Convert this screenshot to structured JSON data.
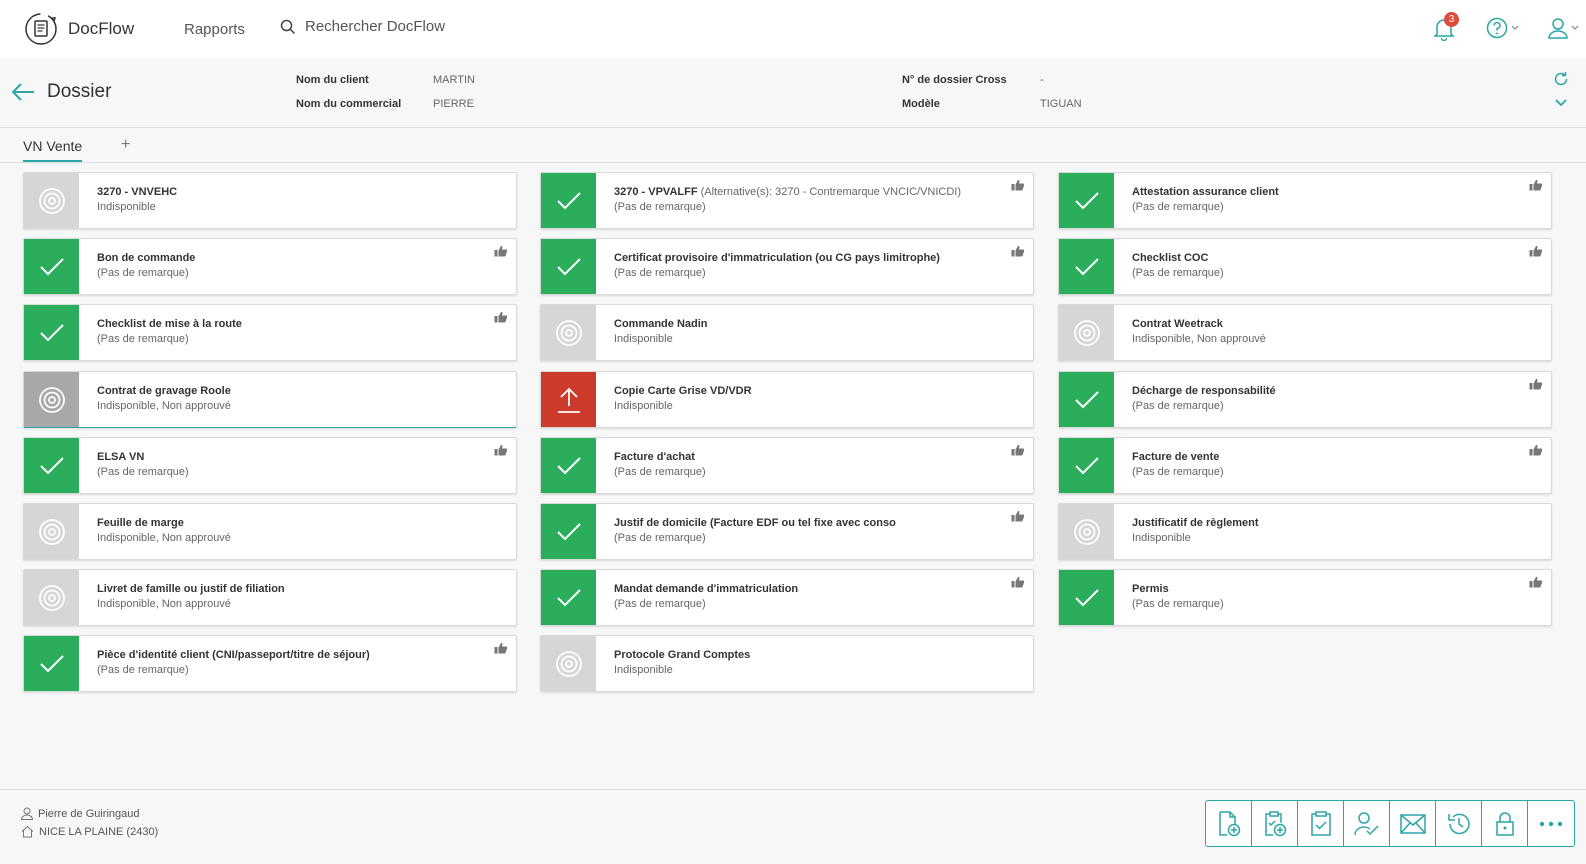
{
  "app": {
    "name": "DocFlow",
    "nav_rapports": "Rapports",
    "search_placeholder": "Rechercher DocFlow",
    "notifications_count": "3"
  },
  "dossier": {
    "title": "Dossier",
    "fields": [
      {
        "label": "Nom du client",
        "value": "MARTIN"
      },
      {
        "label": "Nom du commercial",
        "value": "PIERRE"
      },
      {
        "label": "N° de dossier Cross",
        "value": "-"
      },
      {
        "label": "Modèle",
        "value": "TIGUAN"
      }
    ]
  },
  "tabs": [
    {
      "label": "VN Vente"
    }
  ],
  "tab_add": "+",
  "colors": {
    "ok": "#2bae5c",
    "unavailable": "#d6d6d6",
    "upload": "#cc3a2b",
    "accent": "#2aa6a6"
  },
  "documents": [
    {
      "title": "3270 - VNVEHC",
      "alt": "",
      "status": "Indisponible",
      "state": "unavailable",
      "approved": false
    },
    {
      "title": "3270 - VPVALFF",
      "alt": " (Alternative(s): 3270 - Contremarque VNCIC/VNICDI)",
      "status": "(Pas de remarque)",
      "state": "ok",
      "approved": true
    },
    {
      "title": "Attestation assurance client",
      "alt": "",
      "status": "(Pas de remarque)",
      "state": "ok",
      "approved": true
    },
    {
      "title": "Bon de commande",
      "alt": "",
      "status": "(Pas de remarque)",
      "state": "ok",
      "approved": true
    },
    {
      "title": "Certificat provisoire d'immatriculation (ou CG pays limitrophe)",
      "alt": "",
      "status": "(Pas de remarque)",
      "state": "ok",
      "approved": true
    },
    {
      "title": "Checklist COC",
      "alt": "",
      "status": "(Pas de remarque)",
      "state": "ok",
      "approved": true
    },
    {
      "title": "Checklist de mise à la route",
      "alt": "",
      "status": "(Pas de remarque)",
      "state": "ok",
      "approved": true
    },
    {
      "title": "Commande Nadin",
      "alt": "",
      "status": "Indisponible",
      "state": "unavailable",
      "approved": false
    },
    {
      "title": "Contrat Weetrack",
      "alt": "",
      "status": "Indisponible, Non approuvé",
      "state": "unavailable",
      "approved": false
    },
    {
      "title": "Contrat de gravage Roole",
      "alt": "",
      "status": "Indisponible, Non approuvé",
      "state": "unavailable-focused",
      "approved": false
    },
    {
      "title": "Copie Carte Grise VD/VDR",
      "alt": "",
      "status": "Indisponible",
      "state": "upload",
      "approved": false
    },
    {
      "title": "Décharge de responsabilité",
      "alt": "",
      "status": "(Pas de remarque)",
      "state": "ok",
      "approved": true
    },
    {
      "title": "ELSA VN",
      "alt": "",
      "status": "(Pas de remarque)",
      "state": "ok",
      "approved": true
    },
    {
      "title": "Facture d'achat",
      "alt": "",
      "status": "(Pas de remarque)",
      "state": "ok",
      "approved": true
    },
    {
      "title": "Facture de vente",
      "alt": "",
      "status": "(Pas de remarque)",
      "state": "ok",
      "approved": true
    },
    {
      "title": "Feuille de marge",
      "alt": "",
      "status": "Indisponible, Non approuvé",
      "state": "unavailable",
      "approved": false
    },
    {
      "title": "Justif de domicile (Facture EDF ou tel fixe avec conso",
      "alt": "",
      "status": "(Pas de remarque)",
      "state": "ok",
      "approved": true
    },
    {
      "title": "Justificatif de règlement",
      "alt": "",
      "status": "Indisponible",
      "state": "unavailable",
      "approved": false
    },
    {
      "title": "Livret de famille ou justif de filiation",
      "alt": "",
      "status": "Indisponible, Non approuvé",
      "state": "unavailable",
      "approved": false
    },
    {
      "title": "Mandat demande d'immatriculation",
      "alt": "",
      "status": "(Pas de remarque)",
      "state": "ok",
      "approved": true
    },
    {
      "title": "Permis",
      "alt": "",
      "status": "(Pas de remarque)",
      "state": "ok",
      "approved": true
    },
    {
      "title": "Pièce d'identité client (CNI/passeport/titre de séjour)",
      "alt": "",
      "status": "(Pas de remarque)",
      "state": "ok",
      "approved": true
    },
    {
      "title": "Protocole Grand Comptes",
      "alt": "",
      "status": "Indisponible",
      "state": "unavailable",
      "approved": false
    }
  ],
  "footer": {
    "user": "Pierre de Guiringaud",
    "site": "NICE LA PLAINE (2430)"
  },
  "actions": [
    {
      "name": "add-document-icon"
    },
    {
      "name": "add-checklist-icon"
    },
    {
      "name": "checklist-icon"
    },
    {
      "name": "user-validate-icon"
    },
    {
      "name": "mail-icon"
    },
    {
      "name": "history-icon"
    },
    {
      "name": "lock-icon"
    },
    {
      "name": "more-icon"
    }
  ]
}
